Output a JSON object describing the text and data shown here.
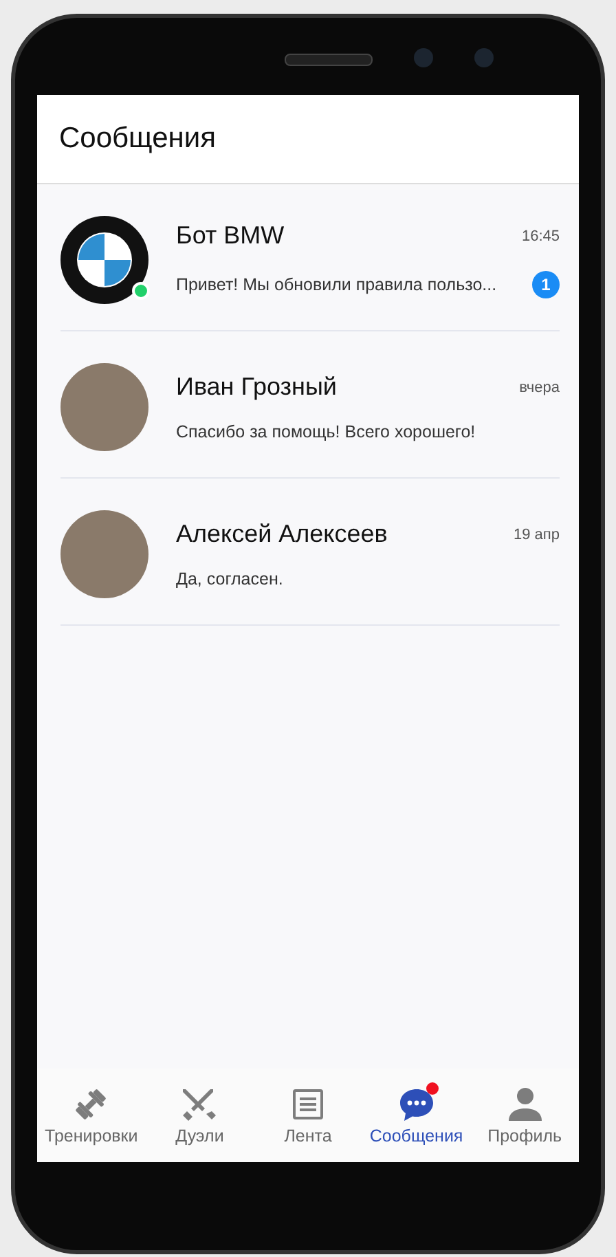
{
  "header": {
    "title": "Сообщения"
  },
  "chats": [
    {
      "kind": "logo",
      "name": "Бот BMW",
      "time": "16:45",
      "preview": "Привет! Мы обновили правила пользо...",
      "online": true,
      "unread": "1"
    },
    {
      "kind": "photo",
      "name": "Иван Грозный",
      "time": "вчера",
      "preview": "Спасибо за помощь! Всего хорошего!",
      "online": false
    },
    {
      "kind": "photo",
      "name": "Алексей Алексеев",
      "time": "19 апр",
      "preview": "Да, согласен.",
      "online": false
    }
  ],
  "tabs": [
    {
      "kind": "dumbbell",
      "label": "Тренировки",
      "selected": false,
      "dot": false
    },
    {
      "kind": "swords",
      "label": "Дуэли",
      "selected": false,
      "dot": false
    },
    {
      "kind": "feed",
      "label": "Лента",
      "selected": false,
      "dot": false
    },
    {
      "kind": "chat",
      "label": "Сообщения",
      "selected": true,
      "dot": true
    },
    {
      "kind": "person",
      "label": "Профиль",
      "selected": false,
      "dot": false
    }
  ]
}
